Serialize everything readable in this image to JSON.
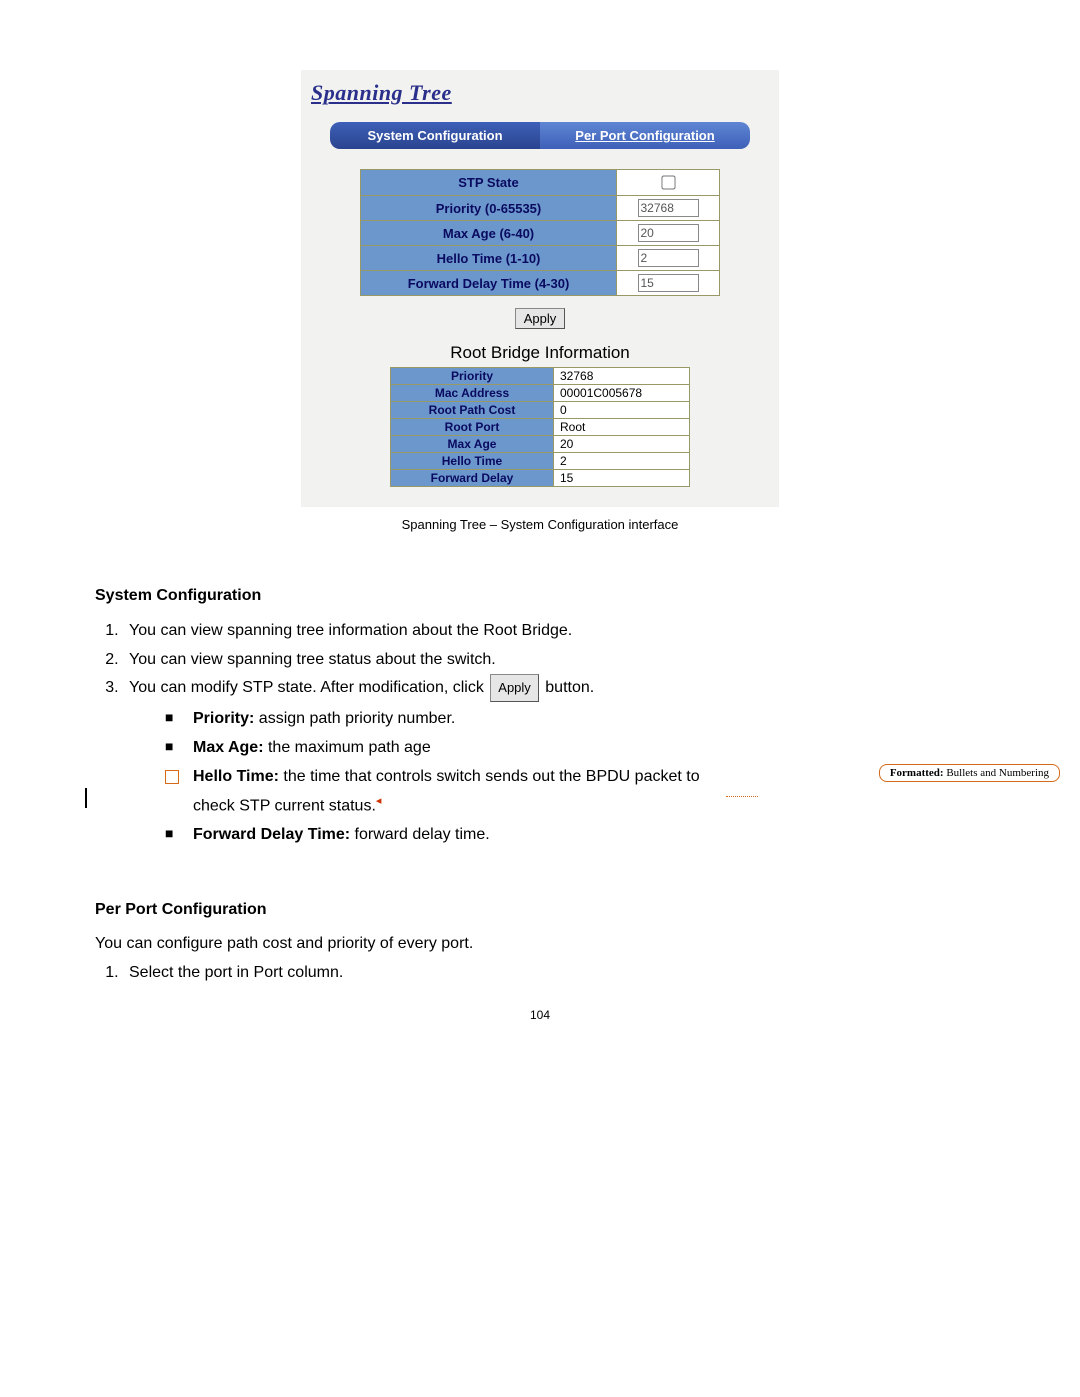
{
  "screenshot": {
    "title": "Spanning Tree",
    "tabs": {
      "active": "System Configuration",
      "inactive": "Per Port Configuration"
    },
    "cfg": [
      {
        "label": "STP State",
        "type": "checkbox",
        "value": ""
      },
      {
        "label": "Priority (0-65535)",
        "type": "text",
        "value": "32768"
      },
      {
        "label": "Max Age (6-40)",
        "type": "text",
        "value": "20"
      },
      {
        "label": "Hello Time (1-10)",
        "type": "text",
        "value": "2"
      },
      {
        "label": "Forward Delay Time (4-30)",
        "type": "text",
        "value": "15"
      }
    ],
    "apply_label": "Apply",
    "root_title": "Root Bridge Information",
    "root": [
      {
        "k": "Priority",
        "v": "32768"
      },
      {
        "k": "Mac Address",
        "v": "00001C005678"
      },
      {
        "k": "Root Path Cost",
        "v": "0"
      },
      {
        "k": "Root Port",
        "v": "Root"
      },
      {
        "k": "Max Age",
        "v": "20"
      },
      {
        "k": "Hello Time",
        "v": "2"
      },
      {
        "k": "Forward Delay",
        "v": "15"
      }
    ]
  },
  "caption": "Spanning Tree – System Configuration interface",
  "section1": {
    "heading": "System Configuration",
    "items": [
      "You can view spanning tree information about the Root Bridge.",
      "You can view spanning tree status about the switch."
    ],
    "item3_a": "You can modify STP state. After modification, click ",
    "item3_btn": "Apply",
    "item3_b": " button.",
    "bullets": [
      {
        "b": "Priority:",
        "t": " assign path priority number."
      },
      {
        "b": "Max Age:",
        "t": " the maximum path age"
      }
    ],
    "bullet3": {
      "b": "Hello Time:",
      "t": " the time that controls switch sends out the BPDU packet to check STP current status."
    },
    "bullet4": {
      "b": "Forward Delay Time:",
      "t": " forward delay time."
    }
  },
  "section2": {
    "heading": "Per Port Configuration",
    "intro": "You can configure path cost and priority of every port.",
    "items": [
      "Select the port in Port column."
    ]
  },
  "comment": {
    "label": "Formatted:",
    "text": " Bullets and Numbering"
  },
  "pagenum": "104"
}
